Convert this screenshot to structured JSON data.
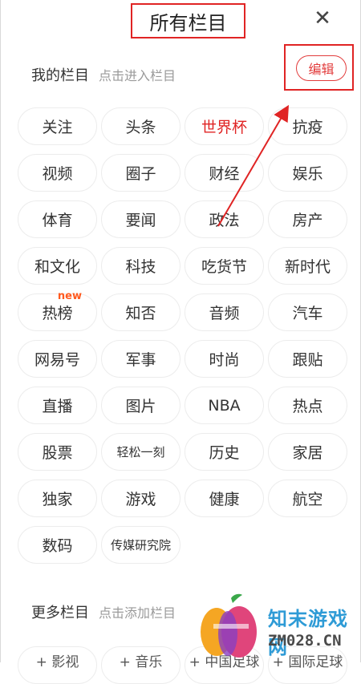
{
  "header": {
    "title": "所有栏目",
    "close_icon": "close-icon"
  },
  "my_columns": {
    "title": "我的栏目",
    "hint": "点击进入栏目",
    "edit_label": "编辑",
    "chips": [
      {
        "label": "关注"
      },
      {
        "label": "头条"
      },
      {
        "label": "世界杯",
        "active": true
      },
      {
        "label": "抗疫"
      },
      {
        "label": "视频"
      },
      {
        "label": "圈子"
      },
      {
        "label": "财经"
      },
      {
        "label": "娱乐"
      },
      {
        "label": "体育"
      },
      {
        "label": "要闻"
      },
      {
        "label": "政法"
      },
      {
        "label": "房产"
      },
      {
        "label": "和文化"
      },
      {
        "label": "科技"
      },
      {
        "label": "吃货节"
      },
      {
        "label": "新时代"
      },
      {
        "label": "热榜",
        "badge": "new"
      },
      {
        "label": "知否"
      },
      {
        "label": "音频"
      },
      {
        "label": "汽车"
      },
      {
        "label": "网易号"
      },
      {
        "label": "军事"
      },
      {
        "label": "时尚"
      },
      {
        "label": "跟贴"
      },
      {
        "label": "直播"
      },
      {
        "label": "图片"
      },
      {
        "label": "NBA"
      },
      {
        "label": "热点"
      },
      {
        "label": "股票"
      },
      {
        "label": "轻松一刻",
        "small": true
      },
      {
        "label": "历史"
      },
      {
        "label": "家居"
      },
      {
        "label": "独家"
      },
      {
        "label": "游戏"
      },
      {
        "label": "健康"
      },
      {
        "label": "航空"
      },
      {
        "label": "数码"
      },
      {
        "label": "传媒研究院",
        "small": true
      }
    ]
  },
  "more_columns": {
    "title": "更多栏目",
    "hint": "点击添加栏目",
    "partial_chips": [
      "+ 影视",
      "+ 音乐",
      "+ 中国足球",
      "+ 国际足球"
    ]
  },
  "watermark": {
    "name": "知末游戏网",
    "domain": "ZM028.CN"
  },
  "colors": {
    "accent": "#e02424",
    "chip_border": "#ececec",
    "hint": "#9a9a9a"
  }
}
